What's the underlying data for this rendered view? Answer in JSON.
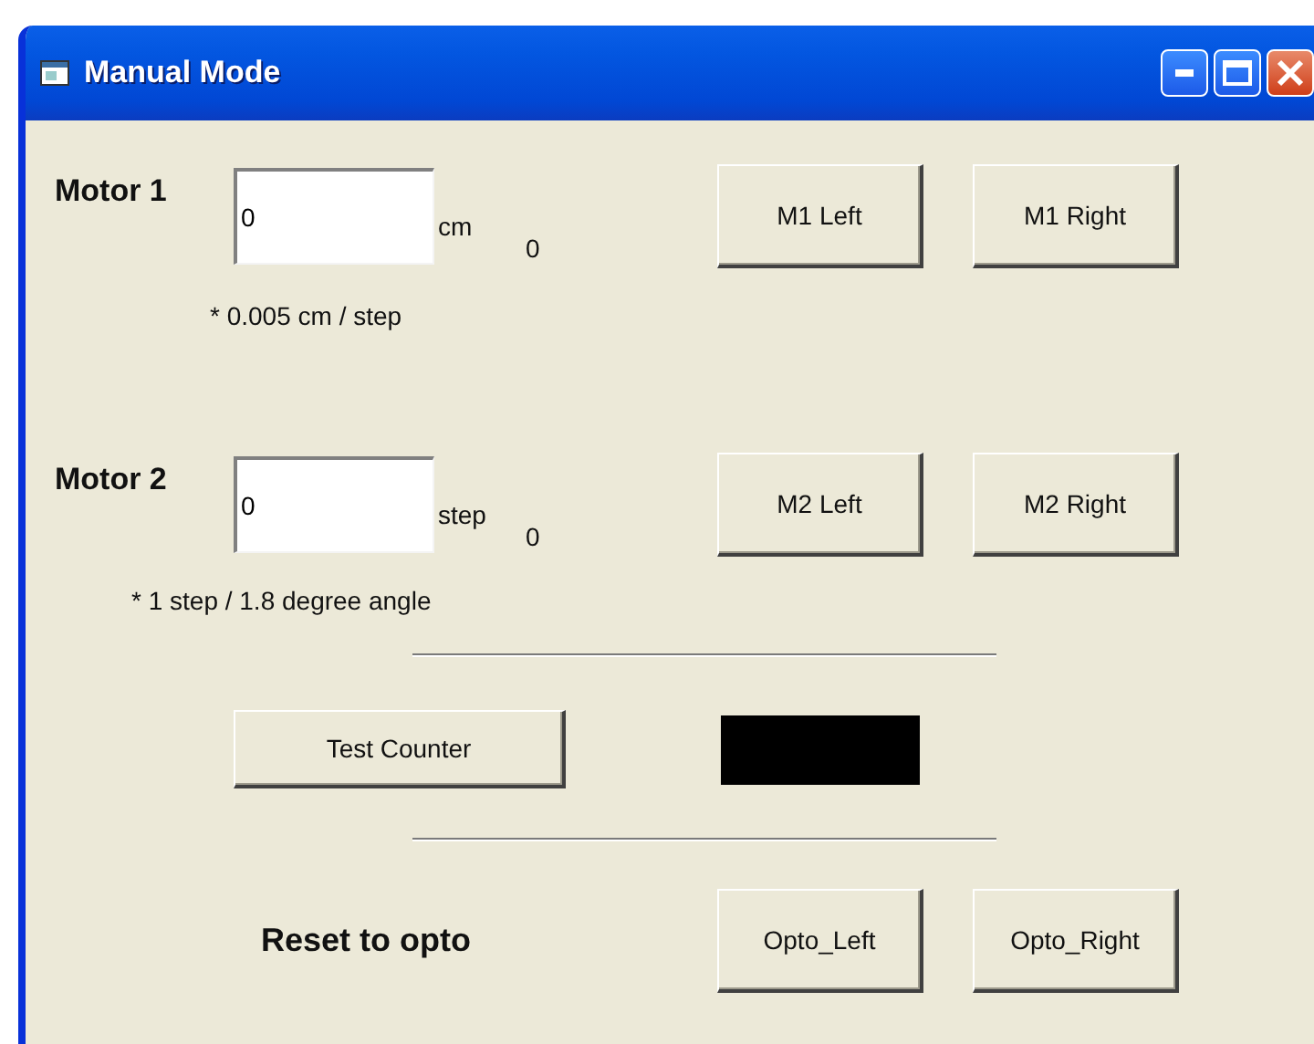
{
  "window": {
    "title": "Manual Mode"
  },
  "motors": [
    {
      "label": "Motor 1",
      "value": "0",
      "unit": "cm",
      "reading": "0",
      "buttons": [
        "M1 Left",
        "M1 Right"
      ],
      "note": "* 0.005 cm / step"
    },
    {
      "label": "Motor 2",
      "value": "0",
      "unit": "step",
      "reading": "0",
      "buttons": [
        "M2 Left",
        "M2 Right"
      ],
      "note": "* 1 step / 1.8 degree angle"
    }
  ],
  "counter": {
    "button": "Test Counter"
  },
  "reset": {
    "label": "Reset to opto",
    "buttons": [
      "Opto_Left",
      "Opto_Right"
    ]
  }
}
